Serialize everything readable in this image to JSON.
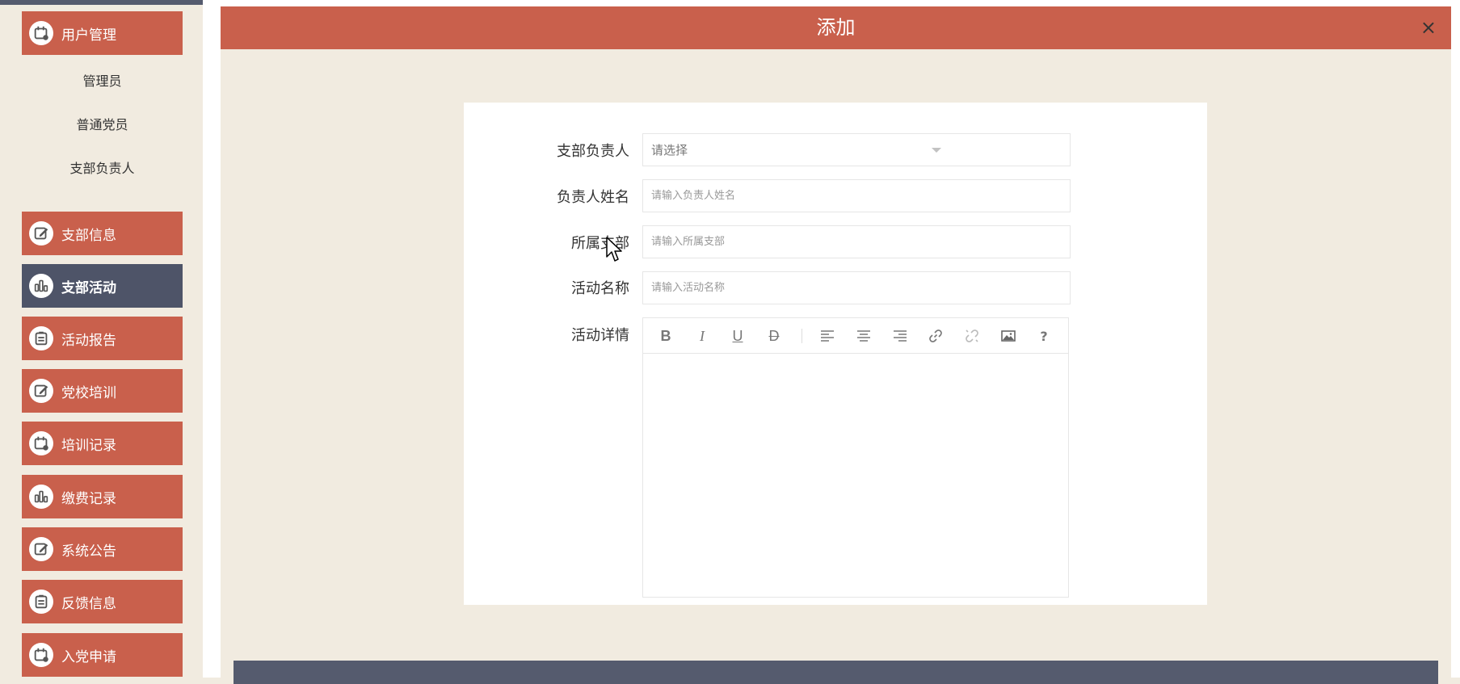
{
  "sidebar": {
    "items": [
      {
        "label": "用户管理",
        "icon": "calendar-person-icon"
      },
      {
        "label": "支部信息",
        "icon": "edit-icon"
      },
      {
        "label": "支部活动",
        "icon": "bar-chart-icon",
        "active": true
      },
      {
        "label": "活动报告",
        "icon": "clipboard-icon"
      },
      {
        "label": "党校培训",
        "icon": "edit-icon"
      },
      {
        "label": "培训记录",
        "icon": "calendar-person-icon"
      },
      {
        "label": "缴费记录",
        "icon": "bar-chart-icon"
      },
      {
        "label": "系统公告",
        "icon": "edit-icon"
      },
      {
        "label": "反馈信息",
        "icon": "clipboard-icon"
      },
      {
        "label": "入党申请",
        "icon": "calendar-person-icon"
      }
    ],
    "subitems": [
      "管理员",
      "普通党员",
      "支部负责人"
    ]
  },
  "modal": {
    "title": "添加",
    "close": "×"
  },
  "form": {
    "branch_leader": {
      "label": "支部负责人",
      "value": "请选择"
    },
    "leader_name": {
      "label": "负责人姓名",
      "placeholder": "请输入负责人姓名"
    },
    "branch": {
      "label": "所属支部",
      "placeholder": "请输入所属支部"
    },
    "activity_name": {
      "label": "活动名称",
      "placeholder": "请输入活动名称"
    },
    "activity_detail": {
      "label": "活动详情"
    }
  },
  "editor": {
    "toolbar": [
      "bold",
      "italic",
      "underline",
      "strikethrough",
      "align-left",
      "align-center",
      "align-right",
      "link",
      "unlink",
      "image",
      "help"
    ],
    "bold": "B",
    "italic": "I",
    "underline": "U",
    "strike": "D",
    "help": "?"
  },
  "colors": {
    "accent": "#c9604c",
    "active": "#4e5468",
    "background": "#f1ebe0"
  }
}
